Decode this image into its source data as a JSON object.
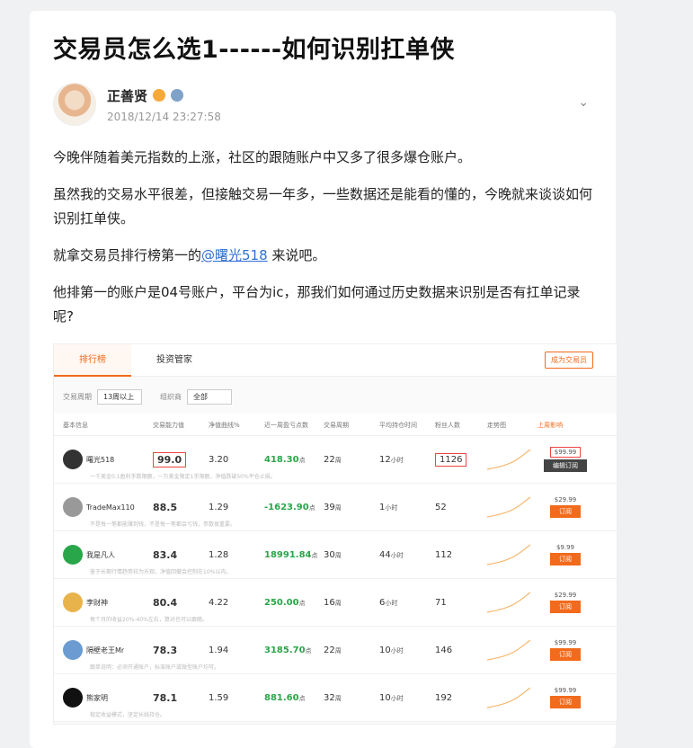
{
  "post": {
    "title": "交易员怎么选1------如何识别扛单侠",
    "author": "正善贤",
    "timestamp": "2018/12/14 23:27:58",
    "paragraphs": [
      "今晚伴随着美元指数的上涨，社区的跟随账户中又多了很多爆仓账户。",
      "虽然我的交易水平很差，但接触交易一年多，一些数据还是能看的懂的，今晚就来谈谈如何识别扛单侠。"
    ],
    "p3_before": "就拿交易员排行榜第一的",
    "p3_mention": "@曙光518",
    "p3_after": " 来说吧。",
    "p4": "他排第一的账户是04号账户，平台为ic，那我们如何通过历史数据来识别是否有扛单记录呢?"
  },
  "screenshot": {
    "tabs": [
      "排行榜",
      "投资管家"
    ],
    "become_button": "成为交易员",
    "filter1_label": "交易周期",
    "filter1_value": "13周以上",
    "filter2_label": "组织商",
    "filter2_value": "全部",
    "headers": [
      "基本信息",
      "交易能力值",
      "净值曲线%",
      "近一周盈亏点数",
      "交易周期",
      "平均持仓时间",
      "粉丝人数",
      "走势图",
      "上周影响"
    ],
    "rows": [
      {
        "name": "曙光518",
        "score": "99.0",
        "ratio": "3.20",
        "points": "418.30",
        "unit": "点",
        "weeks": "22",
        "weeks_unit": "周",
        "hold": "12",
        "hold_unit": "小时",
        "fans": "1126",
        "price": "$99.99",
        "btn": "编辑订阅",
        "note": "一千美金0.1盈利手数限额，一万美金限定1手限额，净值跌破50%平仓止损。"
      },
      {
        "name": "TradeMax110",
        "score": "88.5",
        "ratio": "1.29",
        "points": "-1623.90",
        "unit": "点",
        "weeks": "39",
        "weeks_unit": "周",
        "hold": "1",
        "hold_unit": "小时",
        "fans": "52",
        "price": "$29.99",
        "btn": "订阅",
        "note": "不是每一笔都能赚到钱，不是每一笔都会亏钱，参数很重要。"
      },
      {
        "name": "我是凡人",
        "score": "83.4",
        "ratio": "1.28",
        "points": "18991.84",
        "unit": "点",
        "weeks": "30",
        "weeks_unit": "周",
        "hold": "44",
        "hold_unit": "小时",
        "fans": "112",
        "price": "$9.99",
        "btn": "订阅",
        "note": "鉴于长期行情趋势较为乐观，净值回撤会控制在10%以内。"
      },
      {
        "name": "李财神",
        "score": "80.4",
        "ratio": "4.22",
        "points": "250.00",
        "unit": "点",
        "weeks": "16",
        "weeks_unit": "周",
        "hold": "6",
        "hold_unit": "小时",
        "fans": "71",
        "price": "$29.99",
        "btn": "订阅",
        "note": "每个月的收益20%-40%左右，算对也可以跟随。"
      },
      {
        "name": "隔壁老王Mr",
        "score": "78.3",
        "ratio": "1.94",
        "points": "3185.70",
        "unit": "点",
        "weeks": "22",
        "weeks_unit": "周",
        "hold": "10",
        "hold_unit": "小时",
        "fans": "146",
        "price": "$99.99",
        "btn": "订阅",
        "note": "跟单说明：必须开通账户，标准账户或微型账户均可。"
      },
      {
        "name": "熊家明",
        "score": "78.1",
        "ratio": "1.59",
        "points": "881.60",
        "unit": "点",
        "weeks": "32",
        "weeks_unit": "周",
        "hold": "10",
        "hold_unit": "小时",
        "fans": "192",
        "price": "$99.99",
        "btn": "订阅",
        "note": "稳定收益模式，坚定长线持仓。"
      }
    ]
  },
  "colors": {
    "accent": "#f26a1b",
    "green": "#2aa64a",
    "link": "#2f6fcf"
  }
}
